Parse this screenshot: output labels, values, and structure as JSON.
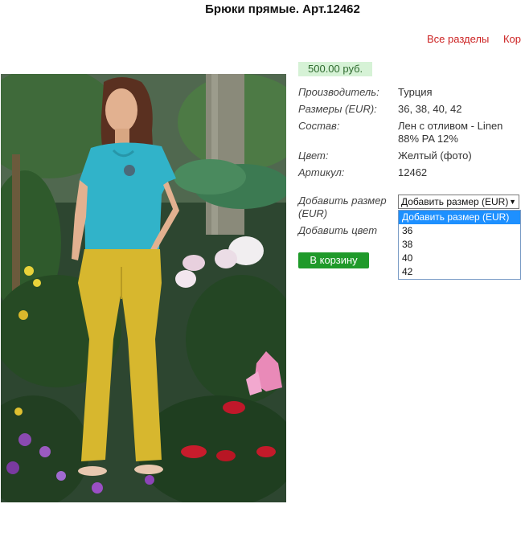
{
  "page": {
    "title": "Брюки прямые. Арт.12462"
  },
  "topnav": {
    "items": [
      "Все разделы",
      "Кор"
    ]
  },
  "product": {
    "price": "500.00 руб.",
    "specs": [
      {
        "label": "Производитель:",
        "value": "Турция"
      },
      {
        "label": "Размеры (EUR):",
        "value": "36, 38, 40, 42"
      },
      {
        "label": "Состав:",
        "value": "Лен с отливом - Linen 88% PA 12%"
      },
      {
        "label": "Цвет:",
        "value": "Желтый (фото)"
      },
      {
        "label": "Артикул:",
        "value": "12462"
      }
    ],
    "add_size_label": "Добавить размер (EUR)",
    "add_color_label": "Добавить цвет",
    "size_select": {
      "value": "Добавить размер (EUR)",
      "options": [
        "Добавить размер (EUR)",
        "36",
        "38",
        "40",
        "42"
      ],
      "highlighted_index": 0
    },
    "cart_button": "В корзину"
  },
  "colors": {
    "nav_link": "#cc2222",
    "price_bg": "#d6f2d6",
    "cart_button": "#1f9a2a",
    "dropdown_highlight": "#1e90ff"
  }
}
